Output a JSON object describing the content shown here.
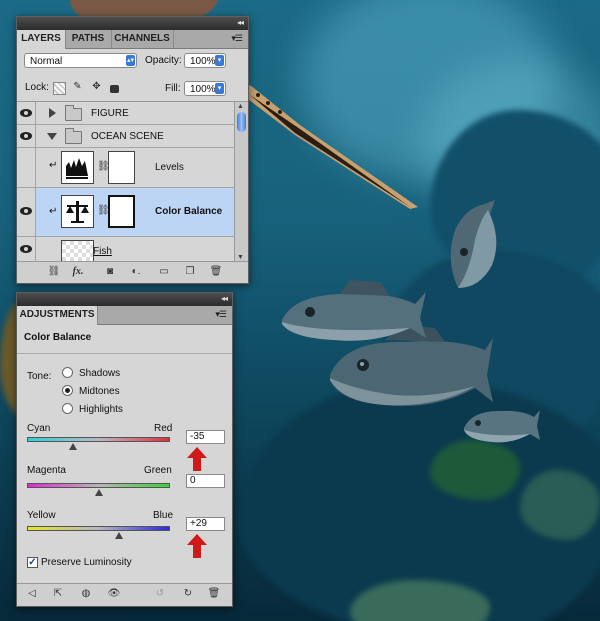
{
  "layers_panel": {
    "tabs": [
      "LAYERS",
      "PATHS",
      "CHANNELS"
    ],
    "blend_mode": "Normal",
    "opacity_label": "Opacity:",
    "opacity_value": "100%",
    "lock_label": "Lock:",
    "fill_label": "Fill:",
    "fill_value": "100%",
    "layers": [
      {
        "name": "FIGURE",
        "type": "group",
        "expanded": false
      },
      {
        "name": "OCEAN SCENE",
        "type": "group",
        "expanded": true
      },
      {
        "name": "Levels",
        "type": "adjustment"
      },
      {
        "name": "Color Balance",
        "type": "adjustment",
        "selected": true
      },
      {
        "name": "Fish",
        "type": "pixel"
      }
    ]
  },
  "adjustments_panel": {
    "tab": "ADJUSTMENTS",
    "title": "Color Balance",
    "tone_label": "Tone:",
    "tones": [
      "Shadows",
      "Midtones",
      "Highlights"
    ],
    "selected_tone": "Midtones",
    "sliders": [
      {
        "left": "Cyan",
        "right": "Red",
        "value": "-35",
        "fraction": 0.325
      },
      {
        "left": "Magenta",
        "right": "Green",
        "value": "0",
        "fraction": 0.5
      },
      {
        "left": "Yellow",
        "right": "Blue",
        "value": "+29",
        "fraction": 0.645
      }
    ],
    "preserve_luminosity_label": "Preserve Luminosity",
    "preserve_luminosity_checked": true
  },
  "colors": {
    "selection_highlight": "#bcd5f4",
    "annotation_arrow": "#d01a1a",
    "accent_blue": "#3a78d6"
  }
}
